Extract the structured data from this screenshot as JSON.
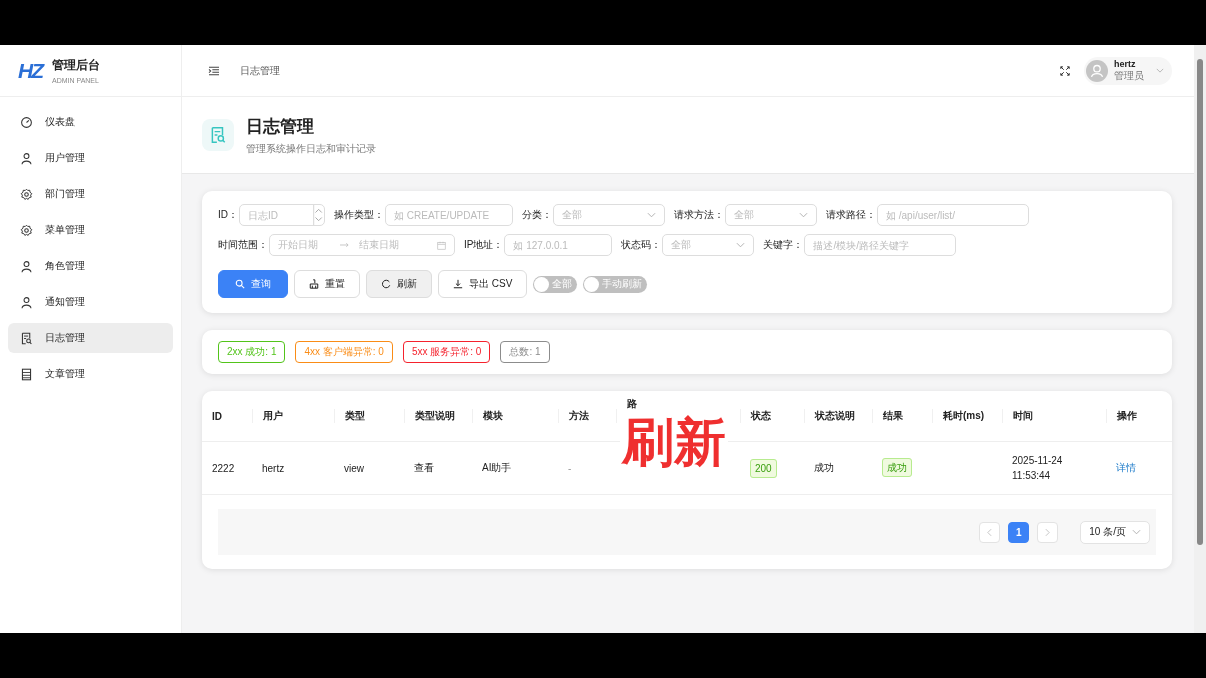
{
  "sidebar": {
    "logo": "HZ",
    "title": "管理后台",
    "subtitle": "ADMIN PANEL",
    "items": [
      {
        "label": "仪表盘",
        "selected": false
      },
      {
        "label": "用户管理",
        "selected": false
      },
      {
        "label": "部门管理",
        "selected": false
      },
      {
        "label": "菜单管理",
        "selected": false
      },
      {
        "label": "角色管理",
        "selected": false
      },
      {
        "label": "通知管理",
        "selected": false
      },
      {
        "label": "日志管理",
        "selected": true
      },
      {
        "label": "文章管理",
        "selected": false
      }
    ]
  },
  "header": {
    "breadcrumb": "日志管理",
    "user": {
      "name": "hertz",
      "role": "管理员"
    }
  },
  "page": {
    "title": "日志管理",
    "subtitle": "管理系统操作日志和审计记录"
  },
  "filter_rows": [
    [
      {
        "kind": "number",
        "label": "ID：",
        "placeholder": "日志ID"
      },
      {
        "kind": "text",
        "label": "操作类型：",
        "placeholder": "如 CREATE/UPDATE"
      },
      {
        "kind": "select",
        "label": "分类：",
        "placeholder": "全部"
      },
      {
        "kind": "select",
        "label": "请求方法：",
        "placeholder": "全部"
      },
      {
        "kind": "text",
        "label": "请求路径：",
        "placeholder": "如 /api/user/list/"
      }
    ],
    [
      {
        "kind": "daterange",
        "label": "时间范围：",
        "placeholder": "开始日期",
        "placeholder_end": "结束日期"
      },
      {
        "kind": "text",
        "label": "IP地址：",
        "placeholder": "如 127.0.0.1"
      },
      {
        "kind": "select",
        "label": "状态码：",
        "placeholder": "全部"
      },
      {
        "kind": "text",
        "label": "关键字：",
        "placeholder": "描述/模块/路径关键字"
      }
    ]
  ],
  "actions": [
    {
      "kind": "primary",
      "label": "查询",
      "hovered": false
    },
    {
      "kind": "default",
      "label": "重置",
      "hovered": false
    },
    {
      "kind": "default",
      "label": "刷新",
      "hovered": true
    },
    {
      "kind": "default",
      "label": "导出 CSV",
      "hovered": false
    }
  ],
  "toggles": [
    {
      "label": "全部",
      "on": false
    },
    {
      "label": "手动刷新",
      "on": false
    }
  ],
  "stats": [
    {
      "label": "2xx 成功: 1",
      "color": "#52c41a"
    },
    {
      "label": "4xx 客户端异常: 0",
      "color": "#fa8c16"
    },
    {
      "label": "5xx 服务异常: 0",
      "color": "#f5222d"
    },
    {
      "label": "总数: 1",
      "color": "#8c8c8c"
    }
  ],
  "table": {
    "columns": [
      {
        "label": "ID"
      },
      {
        "label": "用户"
      },
      {
        "label": "类型"
      },
      {
        "label": "类型说明"
      },
      {
        "label": "模块"
      },
      {
        "label": "方法"
      },
      {
        "label": "路"
      },
      {},
      {
        "label": "状态"
      },
      {
        "label": "状态说明"
      },
      {
        "label": "结果"
      },
      {
        "label": "耗时(ms)"
      },
      {
        "label": "时间"
      },
      {
        "label": "操作"
      }
    ],
    "rows": [
      {
        "id": "2222",
        "user": "hertz",
        "type": "view",
        "type_desc": "查看",
        "module": "AI助手",
        "method": "-",
        "status": "200",
        "status_desc": "成功",
        "result": "成功",
        "time": [
          "2025-11-24",
          "11:53:44"
        ],
        "action": "详情"
      }
    ]
  },
  "pagination": {
    "pages": [
      {
        "label": "1",
        "selected": true
      }
    ],
    "page_size": "10 条/页"
  },
  "caption": "刷新"
}
